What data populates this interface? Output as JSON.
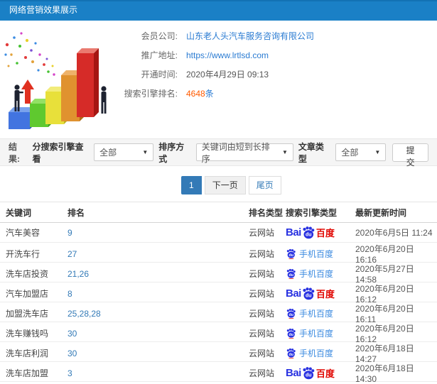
{
  "header": {
    "title": "网络营销效果展示"
  },
  "info": {
    "rows": [
      {
        "label": "会员公司:",
        "value": "山东老人头汽车服务咨询有限公司"
      },
      {
        "label": "推广地址:",
        "value": "https://www.lrtlsd.com"
      },
      {
        "label": "开通时间:",
        "value": "2020年4月29日 09:13"
      },
      {
        "label": "搜索引擎排名:",
        "value": "4648",
        "suffix": "条"
      }
    ]
  },
  "filters": {
    "result_label": "结果:",
    "engine_label": "分搜索引擎查看",
    "engine_value": "全部",
    "sort_label": "排序方式",
    "sort_value": "关键词由短到长排序",
    "article_label": "文章类型",
    "article_value": "全部",
    "submit_label": "提交",
    "caret": "▼"
  },
  "pagination": {
    "current": "1",
    "next_label": "下一页",
    "last_label": "尾页"
  },
  "engines": {
    "baidu": {
      "prefix": "Bai",
      "paw_text": "du",
      "suffix": "百度"
    },
    "mobile": {
      "paw_text": "du",
      "label": "手机百度"
    }
  },
  "table": {
    "headers": [
      "关键词",
      "排名",
      "排名类型",
      "搜索引擎类型",
      "最新更新时间"
    ],
    "rows": [
      {
        "keyword": "汽车美容",
        "rank": "9",
        "rank_type": "云网站",
        "engine": "baidu",
        "updated": "2020年6月5日 11:24"
      },
      {
        "keyword": "开洗车行",
        "rank": "27",
        "rank_type": "云网站",
        "engine": "mobile",
        "updated": "2020年6月20日 16:16"
      },
      {
        "keyword": "洗车店投资",
        "rank": "21,26",
        "rank_type": "云网站",
        "engine": "mobile",
        "updated": "2020年5月27日 14:58"
      },
      {
        "keyword": "汽车加盟店",
        "rank": "8",
        "rank_type": "云网站",
        "engine": "baidu",
        "updated": "2020年6月20日 16:12"
      },
      {
        "keyword": "加盟洗车店",
        "rank": "25,28,28",
        "rank_type": "云网站",
        "engine": "mobile",
        "updated": "2020年6月20日 16:11"
      },
      {
        "keyword": "洗车赚钱吗",
        "rank": "30",
        "rank_type": "云网站",
        "engine": "mobile",
        "updated": "2020年6月20日 16:12"
      },
      {
        "keyword": "洗车店利润",
        "rank": "30",
        "rank_type": "云网站",
        "engine": "mobile",
        "updated": "2020年6月18日 14:27"
      },
      {
        "keyword": "洗车店加盟",
        "rank": "3",
        "rank_type": "云网站",
        "engine": "baidu",
        "updated": "2020年6月18日 14:30"
      }
    ]
  },
  "colors": {
    "topbar_blue": "#1a80c6",
    "link_blue": "#2a7bd2",
    "count_orange": "#ff5a00",
    "rank_blue": "#337ab7",
    "baidu_blue": "#2932e1",
    "baidu_red": "#e10601",
    "mobile_blue": "#3c8be0"
  }
}
